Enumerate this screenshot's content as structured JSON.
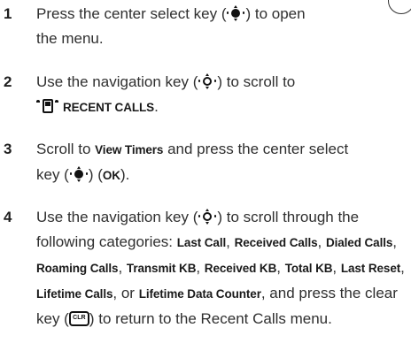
{
  "steps": [
    {
      "number": "1",
      "before_key": "Press the center select key (",
      "after_key": ") to open",
      "line2": "the menu."
    },
    {
      "number": "2",
      "before_key": "Use the navigation key (",
      "after_key": ") to scroll to",
      "menu_item": "RECENT CALLS",
      "after_menu": "."
    },
    {
      "number": "3",
      "text_before": "Scroll to ",
      "view_timers": "View Timers",
      "text_after": " and press the center select",
      "line2_before": "key (",
      "line2_middle": ") (",
      "ok": "OK",
      "line2_after": ")."
    },
    {
      "number": "4",
      "before_key": "Use the navigation key (",
      "after_key": ") to scroll through the",
      "intro": "following categories: ",
      "sep": ", ",
      "or_text": ", or ",
      "categories": [
        "Last Call",
        "Received Calls",
        "Dialed Calls",
        "Roaming Calls",
        "Transmit KB",
        "Received KB",
        "Total KB",
        "Last Reset",
        "Lifetime Calls",
        "Lifetime Data Counter"
      ],
      "after_list": ", and press the clear",
      "clear_before": "key (",
      "clear_key_label": "CLR",
      "clear_after": ") to return to the Recent Calls menu."
    }
  ],
  "icons": {
    "center_select_key": "center-select-key-icon",
    "navigation_key": "navigation-key-icon",
    "recent_calls_menu": "recent-calls-menu-icon",
    "clear_key": "clear-key-icon"
  }
}
